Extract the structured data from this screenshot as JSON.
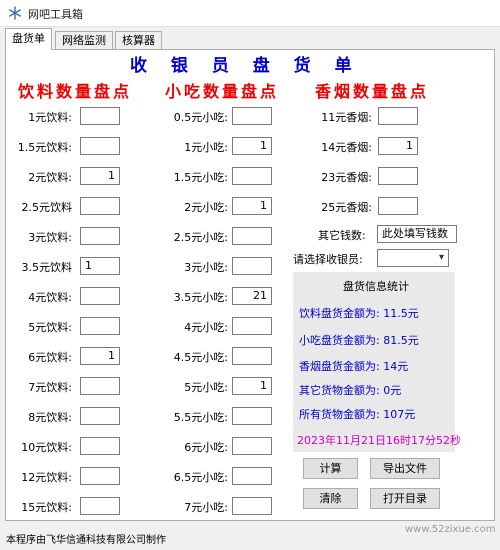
{
  "window": {
    "title": "网吧工具箱"
  },
  "tabs": [
    {
      "label": "盘货单"
    },
    {
      "label": "网络监测"
    },
    {
      "label": "核算器"
    }
  ],
  "sheet": {
    "title": "收 银 员 盘 货 单",
    "drinks": {
      "title": "饮料数量盘点",
      "items": [
        {
          "label": "1元饮料:",
          "value": ""
        },
        {
          "label": "1.5元饮料:",
          "value": ""
        },
        {
          "label": "2元饮料:",
          "value": "1"
        },
        {
          "label": "2.5元饮料",
          "value": ""
        },
        {
          "label": "3元饮料:",
          "value": ""
        },
        {
          "label": "3.5元饮料",
          "value": "1"
        },
        {
          "label": "4元饮料:",
          "value": ""
        },
        {
          "label": "5元饮料:",
          "value": ""
        },
        {
          "label": "6元饮料:",
          "value": "1"
        },
        {
          "label": "7元饮料:",
          "value": ""
        },
        {
          "label": "8元饮料:",
          "value": ""
        },
        {
          "label": "10元饮料:",
          "value": ""
        },
        {
          "label": "12元饮料:",
          "value": ""
        },
        {
          "label": "15元饮料:",
          "value": ""
        }
      ]
    },
    "snacks": {
      "title": "小吃数量盘点",
      "items": [
        {
          "label": "0.5元小吃:",
          "value": ""
        },
        {
          "label": "1元小吃:",
          "value": "1"
        },
        {
          "label": "1.5元小吃:",
          "value": ""
        },
        {
          "label": "2元小吃:",
          "value": "1"
        },
        {
          "label": "2.5元小吃:",
          "value": ""
        },
        {
          "label": "3元小吃:",
          "value": ""
        },
        {
          "label": "3.5元小吃:",
          "value": "21"
        },
        {
          "label": "4元小吃:",
          "value": ""
        },
        {
          "label": "4.5元小吃:",
          "value": ""
        },
        {
          "label": "5元小吃:",
          "value": "1"
        },
        {
          "label": "5.5元小吃:",
          "value": ""
        },
        {
          "label": "6元小吃:",
          "value": ""
        },
        {
          "label": "6.5元小吃:",
          "value": ""
        },
        {
          "label": "7元小吃:",
          "value": ""
        }
      ]
    },
    "cigarettes": {
      "title": "香烟数量盘点",
      "items": [
        {
          "label": "11元香烟:",
          "value": ""
        },
        {
          "label": "14元香烟:",
          "value": "1"
        },
        {
          "label": "23元香烟:",
          "value": ""
        },
        {
          "label": "25元香烟:",
          "value": ""
        }
      ]
    },
    "other_money": {
      "label": "其它钱数:",
      "value": "此处填写钱数"
    },
    "cashier": {
      "label": "请选择收银员:",
      "value": ""
    }
  },
  "summary": {
    "title": "盘货信息统计",
    "drinks": "饮料盘货金额为: 11.5元",
    "snacks": "小吃盘货金额为: 81.5元",
    "cigarettes": "香烟盘货金额为: 14元",
    "other": "其它货物金额为: 0元",
    "total": "所有货物金额为: 107元",
    "timestamp": "2023年11月21日16时17分52秒"
  },
  "buttons": {
    "calc": "计算",
    "export": "导出文件",
    "clear": "清除",
    "open_dir": "打开目录"
  },
  "footer": "本程序由飞华信通科技有限公司制作",
  "watermark": "www.52zixue.com",
  "icons": {
    "app": "snowflake-icon",
    "dropdown": "chevron-down-icon"
  }
}
